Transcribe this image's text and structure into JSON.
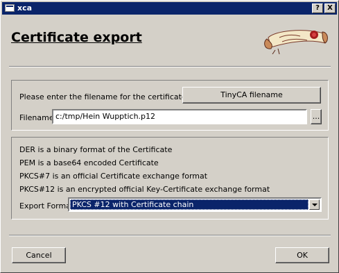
{
  "window": {
    "title": "xca"
  },
  "titlebar_buttons": {
    "help": "?",
    "close": "X"
  },
  "page": {
    "heading": "Certificate export"
  },
  "file_group": {
    "prompt": "Please enter the filename for the certificate.",
    "tinyca_button": "TinyCA filename",
    "filename_label": "Filename",
    "filename_value": "c:/tmp/Hein Wupptich.p12",
    "browse_button": "..."
  },
  "format_group": {
    "lines": [
      "DER is a binary format of the Certificate",
      "PEM is a base64 encoded Certificate",
      "PKCS#7 is an official Certificate exchange format",
      "PKCS#12 is an encrypted official Key-Certificate exchange format"
    ],
    "export_format_label": "Export Format",
    "export_format_value": "PKCS #12 with Certificate chain"
  },
  "footer": {
    "cancel": "Cancel",
    "ok": "OK"
  },
  "colors": {
    "titlebar": "#0a246a",
    "dialog": "#d4d0c8",
    "selection": "#0a246a"
  },
  "icons": [
    "app-window-icon",
    "help-icon",
    "close-icon",
    "certificate-scroll-logo",
    "chevron-down-icon"
  ]
}
